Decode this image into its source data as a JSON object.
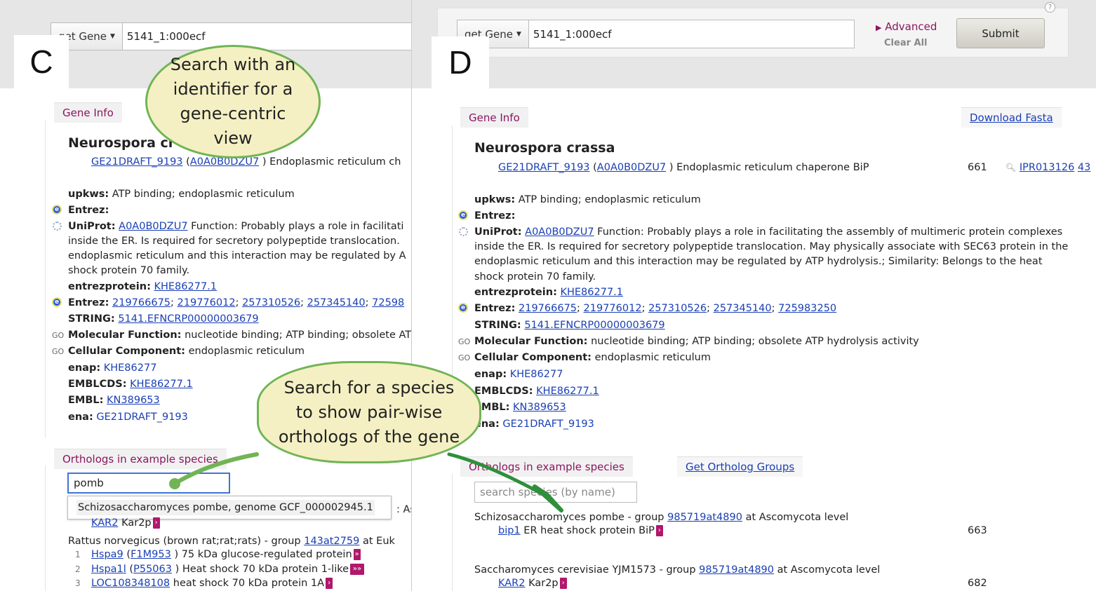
{
  "panel_c": {
    "letter": "C",
    "search": {
      "dropdown": "get Gene",
      "value": "5141_1:000ecf"
    },
    "gene_info_tab": "Gene Info",
    "species_title": "Neurospora cr",
    "gene_line": {
      "gene": "GE21DRAFT_9193",
      "open": "(",
      "accession": "A0A0B0DZU7",
      "desc": ") Endoplasmic reticulum ch"
    },
    "upkws": {
      "label": "upkws:",
      "value": "ATP binding; endoplasmic reticulum"
    },
    "entrez_empty": {
      "label": "Entrez:"
    },
    "uniprot": {
      "label": "UniProt:",
      "link": "A0A0B0DZU7",
      "l1": "Function: Probably plays a role in facilitati",
      "l2": "inside the ER. Is required for secretory polypeptide translocation.",
      "l3": "endoplasmic reticulum and this interaction may be regulated by A",
      "l4": "shock protein 70 family."
    },
    "entrezprotein": {
      "label": "entrezprotein:",
      "link": "KHE86277.1"
    },
    "entrez": {
      "label": "Entrez:",
      "ids": [
        "219766675",
        "219776012",
        "257310526",
        "257345140",
        "72598"
      ]
    },
    "string": {
      "label": "STRING:",
      "link": "5141.EFNCRP00000003679"
    },
    "mf": {
      "icon": "GO",
      "label": "Molecular Function:",
      "value": "nucleotide binding; ATP binding; obsolete AT"
    },
    "cc": {
      "icon": "GO",
      "label": "Cellular Component:",
      "value": "endoplasmic reticulum"
    },
    "enap": {
      "label": "enap:",
      "value": "KHE86277"
    },
    "emblcds": {
      "label": "EMBLCDS:",
      "link": "KHE86277.1"
    },
    "embl": {
      "label": "EMBL:",
      "link": "KN389653"
    },
    "ena": {
      "label": "ena:",
      "value": "GE21DRAFT_9193"
    },
    "orthologs_tab": "Orthologs in example species",
    "species_search_value": "pomb",
    "autocomplete": "Schizosaccharomyces pombe, genome GCF_000002945.1",
    "partial_as": ": As",
    "kar2": {
      "link": "KAR2",
      "desc": "Kar2p"
    },
    "rattus": {
      "text": "Rattus norvegicus (brown rat;rat;rats) - group",
      "group": "143at2759",
      "tail": "at Euk"
    },
    "rows": [
      {
        "n": "1",
        "gene": "Hspa9",
        "acc": "F1M953",
        "desc": ") 75 kDa glucose-regulated protein"
      },
      {
        "n": "2",
        "gene": "Hspa1l",
        "acc": "P55063",
        "desc": ") Heat shock 70 kDa protein 1-like"
      },
      {
        "n": "3",
        "gene": "LOC108348108",
        "acc": "",
        "desc": "heat shock 70 kDa protein 1A"
      }
    ],
    "bubble_top": "Search with an identifier for a gene-centric view",
    "bubble_bottom": "Search for a species to show pair-wise orthologs of the gene"
  },
  "panel_d": {
    "letter": "D",
    "search": {
      "dropdown": "get Gene",
      "value": "5141_1:000ecf"
    },
    "advanced": "Advanced",
    "clear_all": "Clear All",
    "submit": "Submit",
    "help": "?",
    "gene_info_tab": "Gene Info",
    "download_fasta": "Download Fasta",
    "species_title": "Neurospora crassa",
    "gene_line": {
      "gene": "GE21DRAFT_9193",
      "open": "(",
      "accession": "A0A0B0DZU7",
      "desc": ") Endoplasmic reticulum chaperone BiP",
      "length": "661",
      "ipr": "IPR013126",
      "ipr_tail": "43"
    },
    "upkws": {
      "label": "upkws:",
      "value": "ATP binding; endoplasmic reticulum"
    },
    "entrez_empty": {
      "label": "Entrez:"
    },
    "uniprot": {
      "label": "UniProt:",
      "link": "A0A0B0DZU7",
      "l1": "Function: Probably plays a role in facilitating the assembly of multimeric protein complexes",
      "l2": "inside the ER. Is required for secretory polypeptide translocation. May physically associate with SEC63 protein in the",
      "l3": "endoplasmic reticulum and this interaction may be regulated by ATP hydrolysis.; Similarity: Belongs to the heat",
      "l4": "shock protein 70 family."
    },
    "entrezprotein": {
      "label": "entrezprotein:",
      "link": "KHE86277.1"
    },
    "entrez": {
      "label": "Entrez:",
      "ids": [
        "219766675",
        "219776012",
        "257310526",
        "257345140",
        "725983250"
      ]
    },
    "string": {
      "label": "STRING:",
      "link": "5141.EFNCRP00000003679"
    },
    "mf": {
      "icon": "GO",
      "label": "Molecular Function:",
      "value": "nucleotide binding; ATP binding; obsolete ATP hydrolysis activity"
    },
    "cc": {
      "icon": "GO",
      "label": "Cellular Component:",
      "value": "endoplasmic reticulum"
    },
    "enap": {
      "label": "enap:",
      "value": "KHE86277"
    },
    "emblcds": {
      "label": "EMBLCDS:",
      "link": "KHE86277.1"
    },
    "embl": {
      "label": "EMBL:",
      "link": "KN389653"
    },
    "ena": {
      "label": "ena:",
      "value": "GE21DRAFT_9193"
    },
    "orthologs_tab": "Orthologs in example species",
    "get_ortholog_groups": "Get Ortholog Groups",
    "species_search_placeholder": "search species (by name)",
    "pombe": {
      "text": "Schizosaccharomyces pombe - group",
      "group": "985719at4890",
      "tail": "at Ascomycota level",
      "gene": "bip1",
      "desc": "ER heat shock protein BiP",
      "length": "663"
    },
    "cerevisiae": {
      "text": "Saccharomyces cerevisiae YJM1573 - group",
      "group": "985719at4890",
      "tail": "at Ascomycota level",
      "gene": "KAR2",
      "desc": "Kar2p",
      "length": "682"
    }
  },
  "colors": {
    "bubble_fill": "#f4f0c3",
    "bubble_border": "#71b455",
    "tab_text": "#8b1560",
    "link": "#1a3fb5",
    "arrow_tag": "#b0186c"
  }
}
